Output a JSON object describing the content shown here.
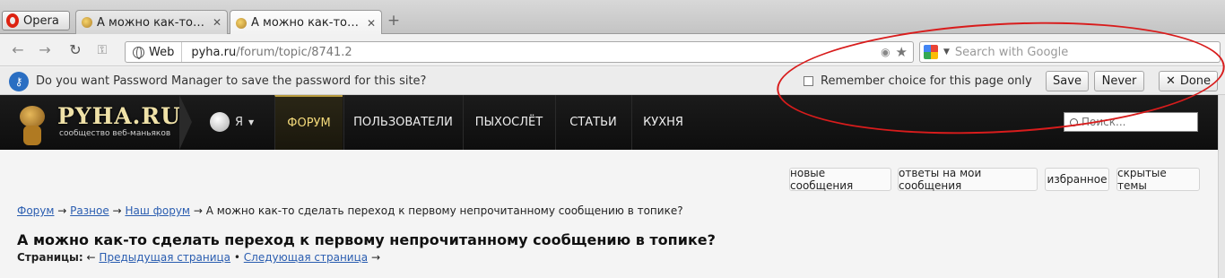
{
  "browser": {
    "menu_label": "Opera",
    "tabs": [
      {
        "title": "А можно как-то с...",
        "close": "✕"
      },
      {
        "title": "А можно как-то с...",
        "close": "✕"
      }
    ],
    "new_tab": "+",
    "site_badge": "Web",
    "url_host": "pyha.ru",
    "url_path": "/forum/topic/8741.2",
    "search_placeholder": "Search with Google"
  },
  "password_bar": {
    "message": "Do you want Password Manager to save the password for this site?",
    "remember_label": "Remember choice for this page only",
    "save_label": "Save",
    "never_label": "Never",
    "done_label": "Done"
  },
  "site": {
    "logo_title": "PYHA.RU",
    "logo_subtitle": "сообщество веб-маньяков",
    "user_label": "Я",
    "nav": [
      {
        "label": "ФОРУМ",
        "active": true
      },
      {
        "label": "ПОЛЬЗОВАТЕЛИ"
      },
      {
        "label": "ПЫХОСЛЁТ"
      },
      {
        "label": "СТАТЬИ"
      },
      {
        "label": "КУХНЯ"
      }
    ],
    "search_placeholder": "Поиск..."
  },
  "content": {
    "actions": [
      "новые сообщения",
      "ответы на мои сообщения",
      "избранное",
      "скрытые темы"
    ],
    "breadcrumb": [
      "Форум",
      "Разное",
      "Наш форум"
    ],
    "breadcrumb_sep": "→",
    "breadcrumb_current": "А можно как-то сделать переход к первому непрочитанному сообщению в топике?",
    "title": "А можно как-то сделать переход к первому непрочитанному сообщению в топике?",
    "pages_label": "Страницы:",
    "prev_arrow": "←",
    "prev_page": "Предыдущая страница",
    "bullet": "•",
    "next_page": "Следующая страница",
    "next_arrow": "→"
  },
  "colors": {
    "annotation": "#d81c1c",
    "link": "#2a5db0",
    "nav_active": "#f2d97a"
  }
}
